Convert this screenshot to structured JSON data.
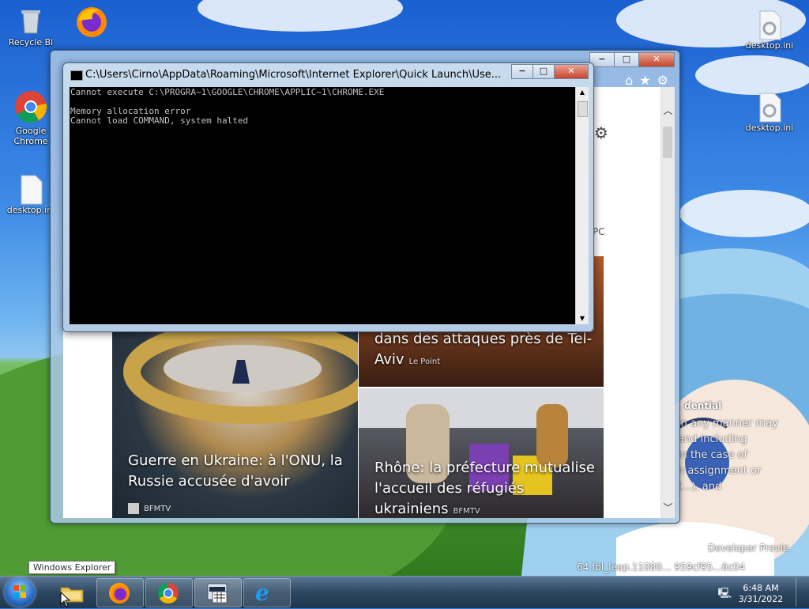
{
  "desktop": {
    "icons": [
      {
        "label": "Recycle Bin",
        "shown": "Recycle Bi"
      },
      {
        "label": "Firefox",
        "shown": ""
      },
      {
        "label": "Google Chrome",
        "shown": "Google Chrome"
      },
      {
        "label": "desktop.ini",
        "shown": "desktop.ini"
      },
      {
        "label": "desktop.ini",
        "shown": "desktop.ini"
      },
      {
        "label": "desktop.ini",
        "shown": "desktop.ini"
      }
    ],
    "watermark_line1": "Developer Previe",
    "watermark_line2": "64.fbl_leap.11080... 959cf95...6c04",
    "confidential_title": "dential",
    "confidential_lines": [
      "in any manner may",
      "and including",
      "in the case of",
      "n assignment or",
      "(...), and"
    ]
  },
  "ie_window": {
    "min_label": "−",
    "max_label": "□",
    "close_label": "✕",
    "tools": [
      "⌂",
      "★",
      "⚙"
    ],
    "peek_text": "PC",
    "news": [
      {
        "title": "dans des attaques près de Tel-Aviv",
        "source": "Le Point"
      },
      {
        "title": "Guerre en Ukraine: à l'ONU, la Russie accusée d'avoir",
        "source": "BFMTV"
      },
      {
        "title": "Rhône: la préfecture mutualise l'accueil des réfugiés ukrainiens",
        "source": "BFMTV"
      }
    ]
  },
  "cmd_window": {
    "title": "C:\\Users\\Cirno\\AppData\\Roaming\\Microsoft\\Internet Explorer\\Quick Launch\\Use...",
    "min_label": "−",
    "max_label": "□",
    "close_label": "✕",
    "lines": [
      "Cannot execute C:\\PROGRA~1\\GOOGLE\\CHROME\\APPLIC~1\\CHROME.EXE",
      "",
      "Memory allocation error",
      "Cannot load COMMAND, system halted"
    ]
  },
  "taskbar": {
    "tooltip": "Windows Explorer",
    "clock_time": "6:48 AM",
    "clock_date": "3/31/2022"
  },
  "colors": {
    "console_bg": "#000000",
    "console_fg": "#c0c0c0",
    "taskbar": "#2c4660"
  }
}
